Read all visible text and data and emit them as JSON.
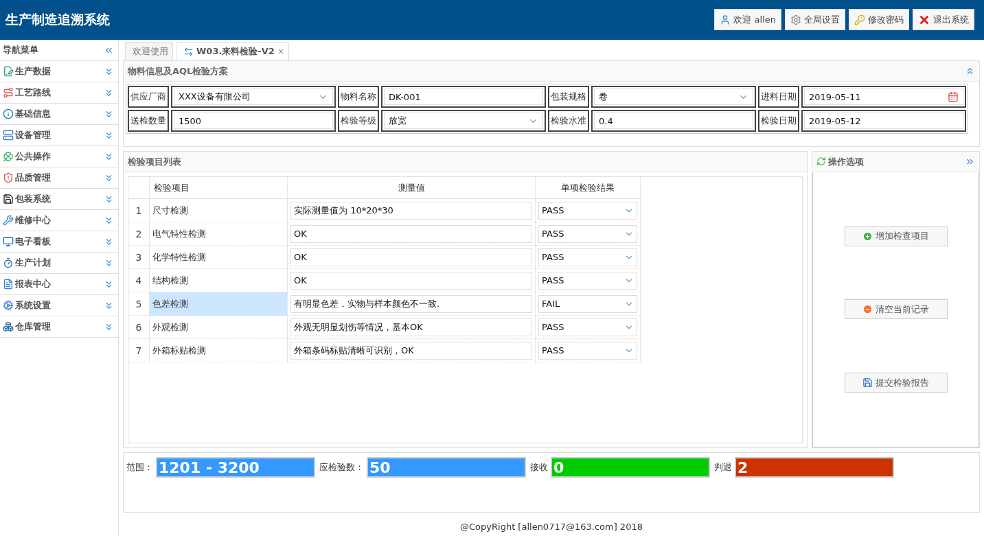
{
  "app": {
    "title": "生产制造追溯系统"
  },
  "header_buttons": [
    {
      "kind": "user",
      "label": "欢迎 allen"
    },
    {
      "kind": "settings",
      "label": "全局设置"
    },
    {
      "kind": "key",
      "label": "修改密码"
    },
    {
      "kind": "exit",
      "label": "退出系统"
    }
  ],
  "sidebar": {
    "title": "导航菜单",
    "items": [
      {
        "kind": "data",
        "label": "生产数据"
      },
      {
        "kind": "route",
        "label": "工艺路线"
      },
      {
        "kind": "info",
        "label": "基础信息"
      },
      {
        "kind": "device",
        "label": "设备管理"
      },
      {
        "kind": "common",
        "label": "公共操作"
      },
      {
        "kind": "quality",
        "label": "品质管理"
      },
      {
        "kind": "pack",
        "label": "包装系统"
      },
      {
        "kind": "repair",
        "label": "维修中心"
      },
      {
        "kind": "board",
        "label": "电子看板"
      },
      {
        "kind": "plan",
        "label": "生产计划"
      },
      {
        "kind": "report",
        "label": "报表中心"
      },
      {
        "kind": "system",
        "label": "系统设置"
      },
      {
        "kind": "warehouse",
        "label": "仓库管理"
      }
    ]
  },
  "tabs": [
    {
      "label": "欢迎使用",
      "selected": false
    },
    {
      "label": "W03.来料检验-V2",
      "selected": true,
      "close": "×"
    }
  ],
  "material_panel": {
    "title": "物料信息及AQL检验方案",
    "fields": [
      {
        "label": "供应厂商",
        "kind": "select",
        "value": "XXX设备有限公司"
      },
      {
        "label": "物料名称",
        "kind": "text",
        "value": "DK-001"
      },
      {
        "label": "包装规格",
        "kind": "select",
        "value": "卷"
      },
      {
        "label": "进料日期",
        "kind": "date",
        "value": "2019-05-11"
      },
      {
        "label": "送检数量",
        "kind": "text",
        "value": "1500"
      },
      {
        "label": "检验等级",
        "kind": "select",
        "value": "放宽"
      },
      {
        "label": "检验水准",
        "kind": "text",
        "value": "0.4"
      },
      {
        "label": "检验日期",
        "kind": "text",
        "value": "2019-05-12"
      }
    ]
  },
  "inspection_list": {
    "title": "检验项目列表",
    "columns": [
      "检验项目",
      "测量值",
      "单项检验结果"
    ],
    "rows": [
      {
        "no": "1",
        "item": "尺寸检测",
        "value": "实际测量值为 10*20*30",
        "result": "PASS",
        "selected": false
      },
      {
        "no": "2",
        "item": "电气特性检测",
        "value": "OK",
        "result": "PASS",
        "selected": false
      },
      {
        "no": "3",
        "item": "化学特性检测",
        "value": "OK",
        "result": "PASS",
        "selected": false
      },
      {
        "no": "4",
        "item": "结构检测",
        "value": "OK",
        "result": "PASS",
        "selected": false
      },
      {
        "no": "5",
        "item": "色差检测",
        "value": "有明显色差，实物与样本颜色不一致.",
        "result": "FAIL",
        "selected": true
      },
      {
        "no": "6",
        "item": "外观检测",
        "value": "外观无明显划伤等情况，基本OK",
        "result": "PASS",
        "selected": false
      },
      {
        "no": "7",
        "item": "外箱标贴检测",
        "value": "外箱条码标贴清晰可识别，OK",
        "result": "PASS",
        "selected": false
      }
    ]
  },
  "actions": {
    "title": "操作选项",
    "buttons": [
      {
        "kind": "add",
        "label": "增加检查项目"
      },
      {
        "kind": "clear",
        "label": "清空当前记录"
      },
      {
        "kind": "save",
        "label": "提交检验报告"
      }
    ]
  },
  "summary": [
    {
      "label": "范围：",
      "value": "1201 - 3200",
      "color": "#3399ff"
    },
    {
      "label": "应检验数：",
      "value": "50",
      "color": "#3399ff"
    },
    {
      "label": "接收",
      "value": "0",
      "color": "#00cc00"
    },
    {
      "label": "判退",
      "value": "2",
      "color": "#cc3300"
    }
  ],
  "footer": "@CopyRight [allen0717@163.com] 2018"
}
